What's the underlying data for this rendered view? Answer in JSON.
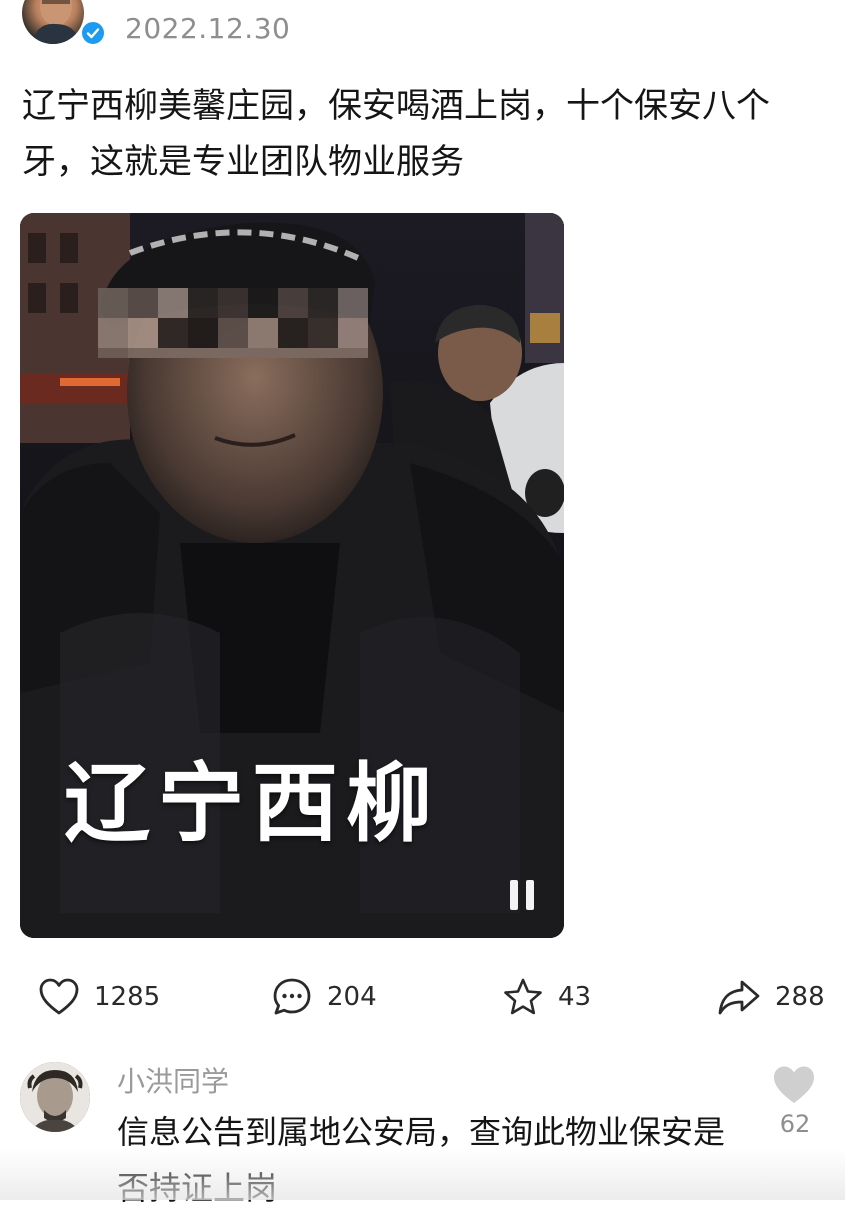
{
  "post": {
    "date": "2022.12.30",
    "text": "辽宁西柳美馨庄园，保安喝酒上岗，十个保安八个牙，这就是专业团队物业服务",
    "author_avatar_icon": "avatar",
    "verified_icon": "check-icon"
  },
  "video": {
    "caption": "辽宁西柳",
    "paused_icon": "pause-icon"
  },
  "actions": {
    "like_count": "1285",
    "comment_count": "204",
    "favorite_count": "43",
    "share_count": "288"
  },
  "comment": {
    "username": "小洪同学",
    "text": "信息公告到属地公安局，查询此物业保安是否持证上岗",
    "like_count": "62"
  },
  "colors": {
    "accent_blue": "#1d9bf0",
    "text": "#151515",
    "muted": "#8e8e8e"
  }
}
